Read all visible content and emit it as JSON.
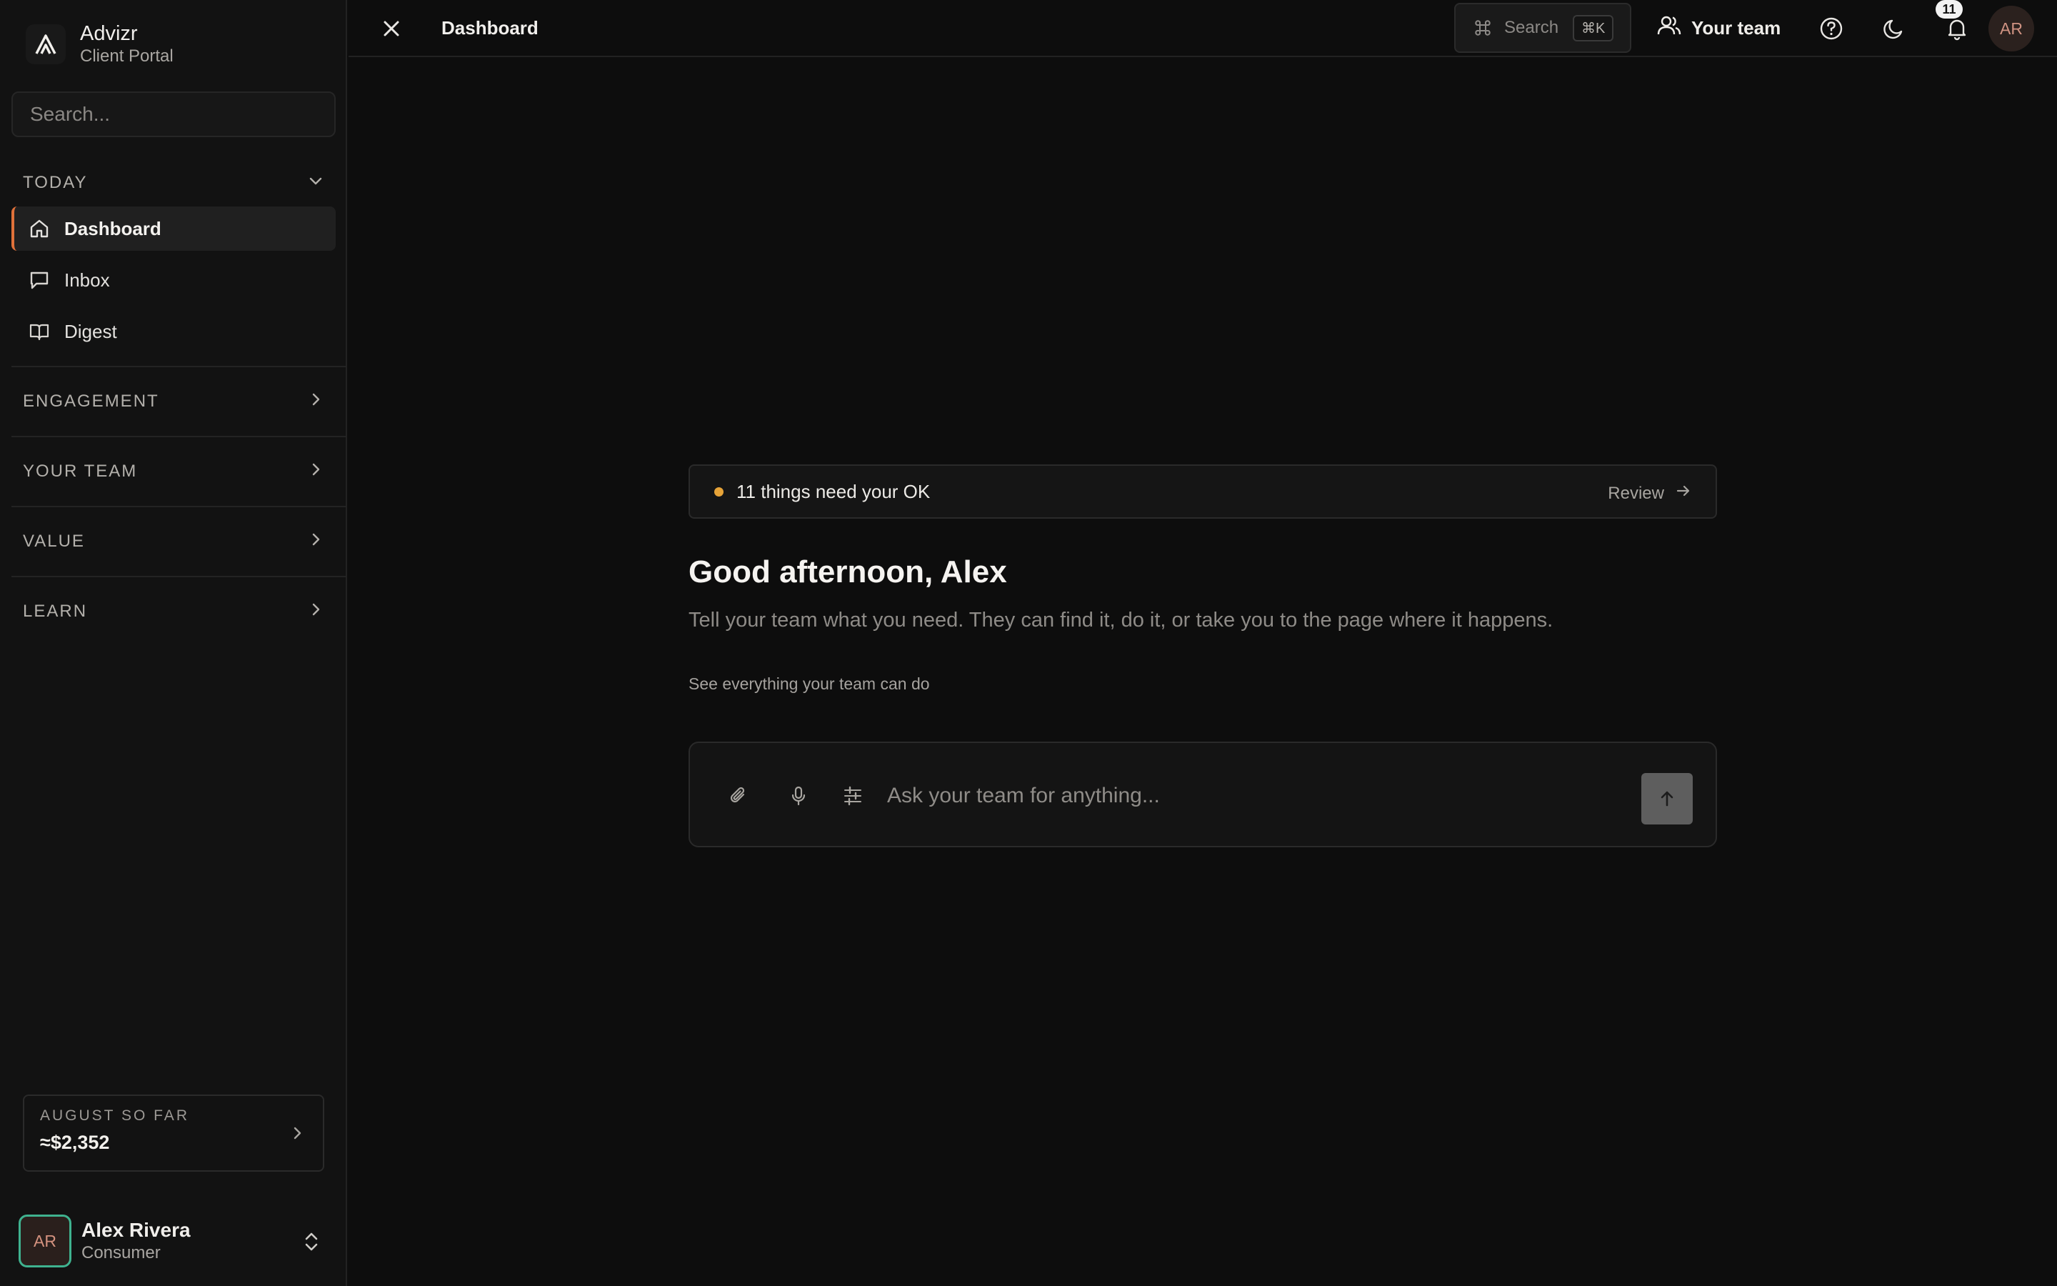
{
  "brand": {
    "name": "Advizr",
    "subtitle": "Client Portal"
  },
  "sidebar": {
    "search_placeholder": "Search...",
    "sections": {
      "today": "TODAY",
      "engagement": "ENGAGEMENT",
      "your_team": "YOUR TEAM",
      "value": "VALUE",
      "learn": "LEARN"
    },
    "items": [
      {
        "label": "Dashboard",
        "icon": "home-icon",
        "active": true
      },
      {
        "label": "Inbox",
        "icon": "message-icon",
        "active": false
      },
      {
        "label": "Digest",
        "icon": "book-icon",
        "active": false
      }
    ],
    "spend": {
      "label": "AUGUST SO FAR",
      "value": "≈$2,352"
    },
    "user": {
      "initials": "AR",
      "name": "Alex Rivera",
      "role": "Consumer"
    }
  },
  "topbar": {
    "breadcrumb": "Dashboard",
    "search_label": "Search",
    "search_shortcut": "⌘K",
    "team_label": "Your team",
    "notification_count": "11",
    "avatar_initials": "AR"
  },
  "main": {
    "approvals": {
      "message": "11 things need your OK",
      "action": "Review"
    },
    "greeting": "Good afternoon, Alex",
    "subtitle": "Tell your team what you need. They can find it, do it, or take you to the page where it happens.",
    "see_all": "See everything your team can do",
    "composer": {
      "placeholder": "Ask your team for anything..."
    }
  },
  "colors": {
    "background": "#0d0d0d",
    "sidebar": "#121212",
    "accent": "#e0713a",
    "pending_dot": "#e6a338",
    "avatar_ring": "#3fb28f"
  }
}
